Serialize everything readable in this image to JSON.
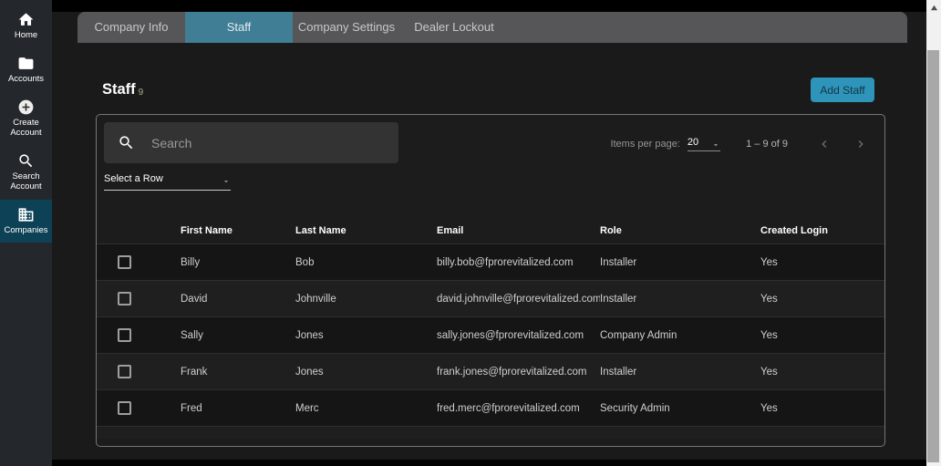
{
  "sidebar": {
    "items": [
      {
        "label": "Home"
      },
      {
        "label": "Accounts"
      },
      {
        "label": "Create Account"
      },
      {
        "label": "Search Account"
      },
      {
        "label": "Companies"
      }
    ]
  },
  "tabs": [
    {
      "label": "Company Info"
    },
    {
      "label": "Staff"
    },
    {
      "label": "Company Settings"
    },
    {
      "label": "Dealer Lockout"
    }
  ],
  "staff_page": {
    "title": "Staff",
    "count": "9",
    "add_staff_label": "Add Staff"
  },
  "search": {
    "placeholder": "Search"
  },
  "row_select": {
    "label": "Select a Row"
  },
  "pagination": {
    "items_per_page_label": "Items per page:",
    "items_per_page_value": "20",
    "range_text": "1 – 9 of 9"
  },
  "table": {
    "columns": [
      "First Name",
      "Last Name",
      "Email",
      "Role",
      "Created Login"
    ],
    "rows": [
      {
        "first_name": "Billy",
        "last_name": "Bob",
        "email": "billy.bob@fprorevitalized.com",
        "role": "Installer",
        "created_login": "Yes"
      },
      {
        "first_name": "David",
        "last_name": "Johnville",
        "email": "david.johnville@fprorevitalized.com",
        "role": "Installer",
        "created_login": "Yes"
      },
      {
        "first_name": "Sally",
        "last_name": "Jones",
        "email": "sally.jones@fprorevitalized.com",
        "role": "Company Admin",
        "created_login": "Yes"
      },
      {
        "first_name": "Frank",
        "last_name": "Jones",
        "email": "frank.jones@fprorevitalized.com",
        "role": "Installer",
        "created_login": "Yes"
      },
      {
        "first_name": "Fred",
        "last_name": "Merc",
        "email": "fred.merc@fprorevitalized.com",
        "role": "Security Admin",
        "created_login": "Yes"
      }
    ]
  },
  "colors": {
    "active_tab": "#3f7e95",
    "add_button": "#2e94b9",
    "sidebar_active": "#0d4156"
  }
}
